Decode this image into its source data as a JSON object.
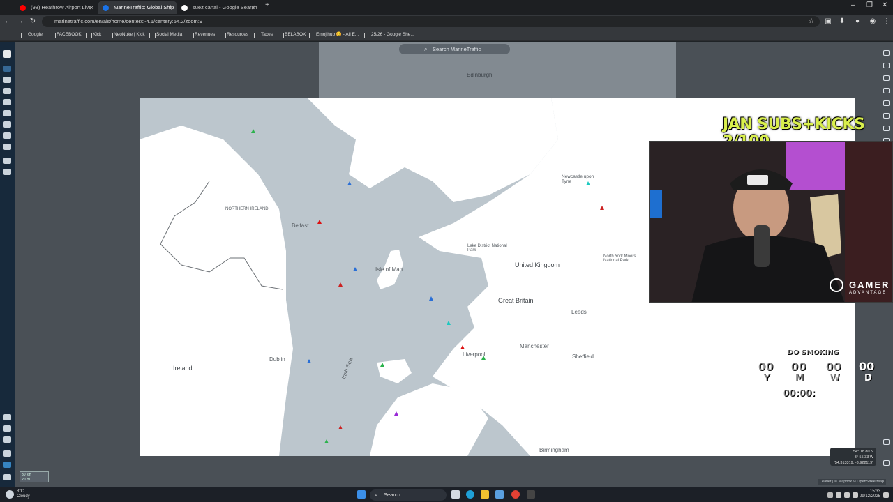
{
  "browser": {
    "tabs": [
      {
        "title": "(98) Heathrow Airport Live",
        "favicon_color": "#ff0000",
        "active": false
      },
      {
        "title": "MarineTraffic: Global Ship Track",
        "favicon_color": "#1a73e8",
        "active": true
      },
      {
        "title": "suez canal - Google Search",
        "favicon_color": "#ffffff",
        "active": false
      }
    ],
    "new_tab_label": "+",
    "url": "marinetraffic.com/en/ais/home/centerx:-4.1/centery:54.2/zoom:9",
    "bookmarks": [
      "Google",
      "FACEBOOK",
      "Kick",
      "NeoNuke | Kick",
      "Social Media",
      "Revenues",
      "Resources",
      "Taxes",
      "BELABOX",
      "Emojihub 😊 - All E...",
      "25/26 - Google She..."
    ]
  },
  "page": {
    "search_placeholder": "Search MarineTraffic",
    "map_labels": {
      "northern_ireland": "NORTHERN IRELAND",
      "belfast": "Belfast",
      "isle_of_man": "Isle of Man",
      "united_kingdom": "United Kingdom",
      "great_britain": "Great Britain",
      "ireland": "Ireland",
      "dublin": "Dublin",
      "irish_sea": "Irish Sea",
      "liverpool": "Liverpool",
      "manchester": "Manchester",
      "leeds": "Leeds",
      "sheffield": "Sheffield",
      "birmingham": "Birmingham",
      "newcastle": "Newcastle upon Tyne",
      "lake_district": "Lake District National Park",
      "york_moors": "North York Moors National Park",
      "edinburgh": "Edinburgh"
    },
    "coords": {
      "lat": "54° 18.80 N",
      "lon": "3° 55.33 W",
      "decimal": "(54.313319, -3.922119)"
    },
    "attribution": "Leaflet | © Mapbox © OpenStreetMap",
    "scale": {
      "km": "30 km",
      "mi": "20 mi"
    }
  },
  "overlay": {
    "banner": "JAN SUBS+KICKS 2/100",
    "brand": "GAMER",
    "brand_sub": "ADVANTAGE",
    "timer_heading": "DO SMOKING",
    "timer_values": [
      "00",
      "00",
      "00",
      "00"
    ],
    "timer_units": [
      "Y",
      "M",
      "W",
      "D"
    ],
    "timer_time": "00:00:"
  },
  "taskbar": {
    "weather_temp": "8°C",
    "weather_desc": "Cloudy",
    "search_label": "Search",
    "time": "15:33",
    "date": "29/12/2025"
  },
  "colors": {
    "map_land": "#ffffff",
    "map_sea": "#bcc6cd",
    "sidebar": "#17293b",
    "banner": "#d9ef4d"
  }
}
